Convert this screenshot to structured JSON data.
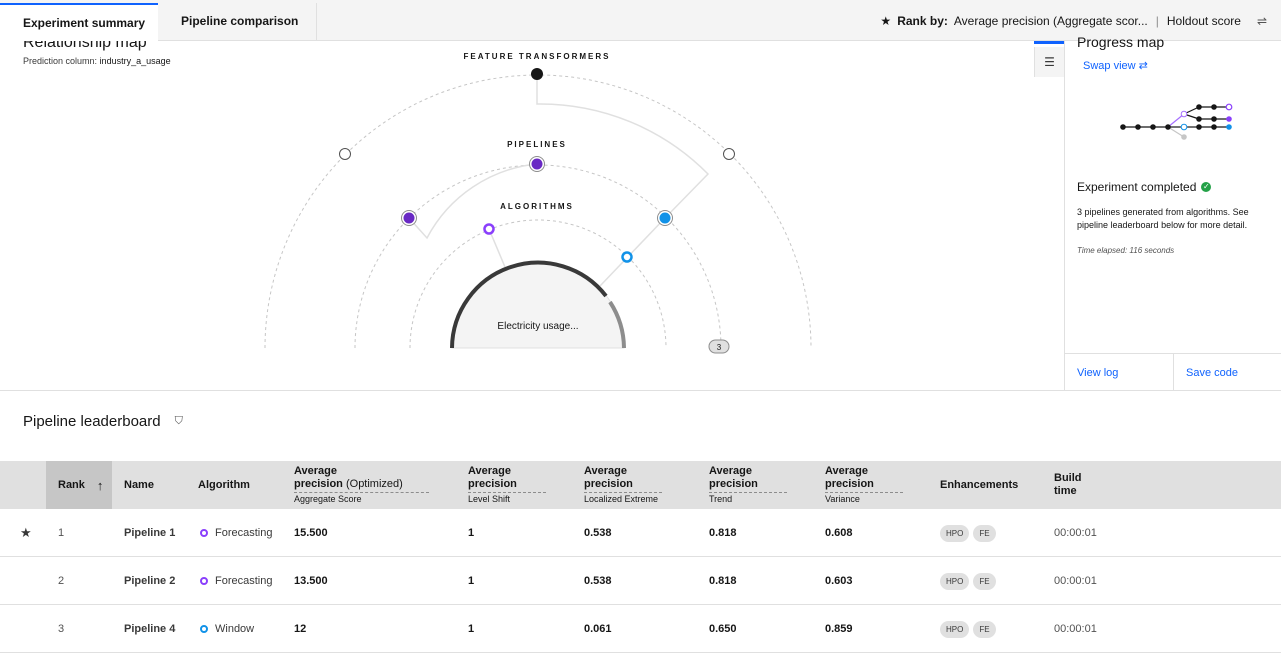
{
  "tabs": {
    "summary": "Experiment summary",
    "comparison": "Pipeline comparison"
  },
  "rank": {
    "star": "★",
    "label": "Rank by:",
    "metric": "Average precision (Aggregate scor...",
    "separator": "|",
    "holdout": "Holdout score",
    "settings_icon": "⇌"
  },
  "map": {
    "title": "Relationship map",
    "prediction_label": "Prediction column:",
    "prediction_value": "industry_a_usage",
    "ring_feature": "FEATURE TRANSFORMERS",
    "ring_pipelines": "PIPELINES",
    "ring_algorithms": "ALGORITHMS",
    "center": "Electricity usage...",
    "badge": "3",
    "list_icon": "☰"
  },
  "progress": {
    "title": "Progress map",
    "swap": "Swap view",
    "swap_icon": "⇄",
    "completed": "Experiment completed",
    "check": "✓",
    "description": "3 pipelines generated from algorithms. See pipeline leaderboard below for more detail.",
    "elapsed": "Time elapsed: 116 seconds",
    "view_log": "View log",
    "save_code": "Save code"
  },
  "leaderboard": {
    "title": "Pipeline leaderboard",
    "filter_icon": "⛉",
    "headers": {
      "rank": "Rank",
      "sort_icon": "↑",
      "name": "Name",
      "algorithm": "Algorithm",
      "avg1_a": "Average",
      "avg1_b": "precision",
      "avg1_opt": "(Optimized)",
      "avg1_sub": "Aggregate Score",
      "avg2_a": "Average",
      "avg2_b": "precision",
      "avg2_sub": "Level Shift",
      "avg3_a": "Average",
      "avg3_b": "precision",
      "avg3_sub": "Localized Extreme",
      "avg4_a": "Average",
      "avg4_b": "precision",
      "avg4_sub": "Trend",
      "avg5_a": "Average",
      "avg5_b": "precision",
      "avg5_sub": "Variance",
      "enhancements": "Enhancements",
      "build_a": "Build",
      "build_b": "time"
    },
    "rows": [
      {
        "star": "★",
        "rank": "1",
        "name": "Pipeline 1",
        "algorithm": "Forecasting",
        "aggregate": "15.500",
        "level_shift": "1",
        "localized": "0.538",
        "trend": "0.818",
        "variance": "0.608",
        "tag1": "HPO",
        "tag2": "FE",
        "build": "00:00:01"
      },
      {
        "star": "",
        "rank": "2",
        "name": "Pipeline 2",
        "algorithm": "Forecasting",
        "aggregate": "13.500",
        "level_shift": "1",
        "localized": "0.538",
        "trend": "0.818",
        "variance": "0.603",
        "tag1": "HPO",
        "tag2": "FE",
        "build": "00:00:01"
      },
      {
        "star": "",
        "rank": "3",
        "name": "Pipeline 4",
        "algorithm": "Window",
        "aggregate": "12",
        "level_shift": "1",
        "localized": "0.061",
        "trend": "0.650",
        "variance": "0.859",
        "tag1": "HPO",
        "tag2": "FE",
        "build": "00:00:01"
      }
    ]
  },
  "colors": {
    "accent": "#0f62fe",
    "purple": "#8a3ffc",
    "blue": "#1192e8",
    "success": "#24a148"
  }
}
